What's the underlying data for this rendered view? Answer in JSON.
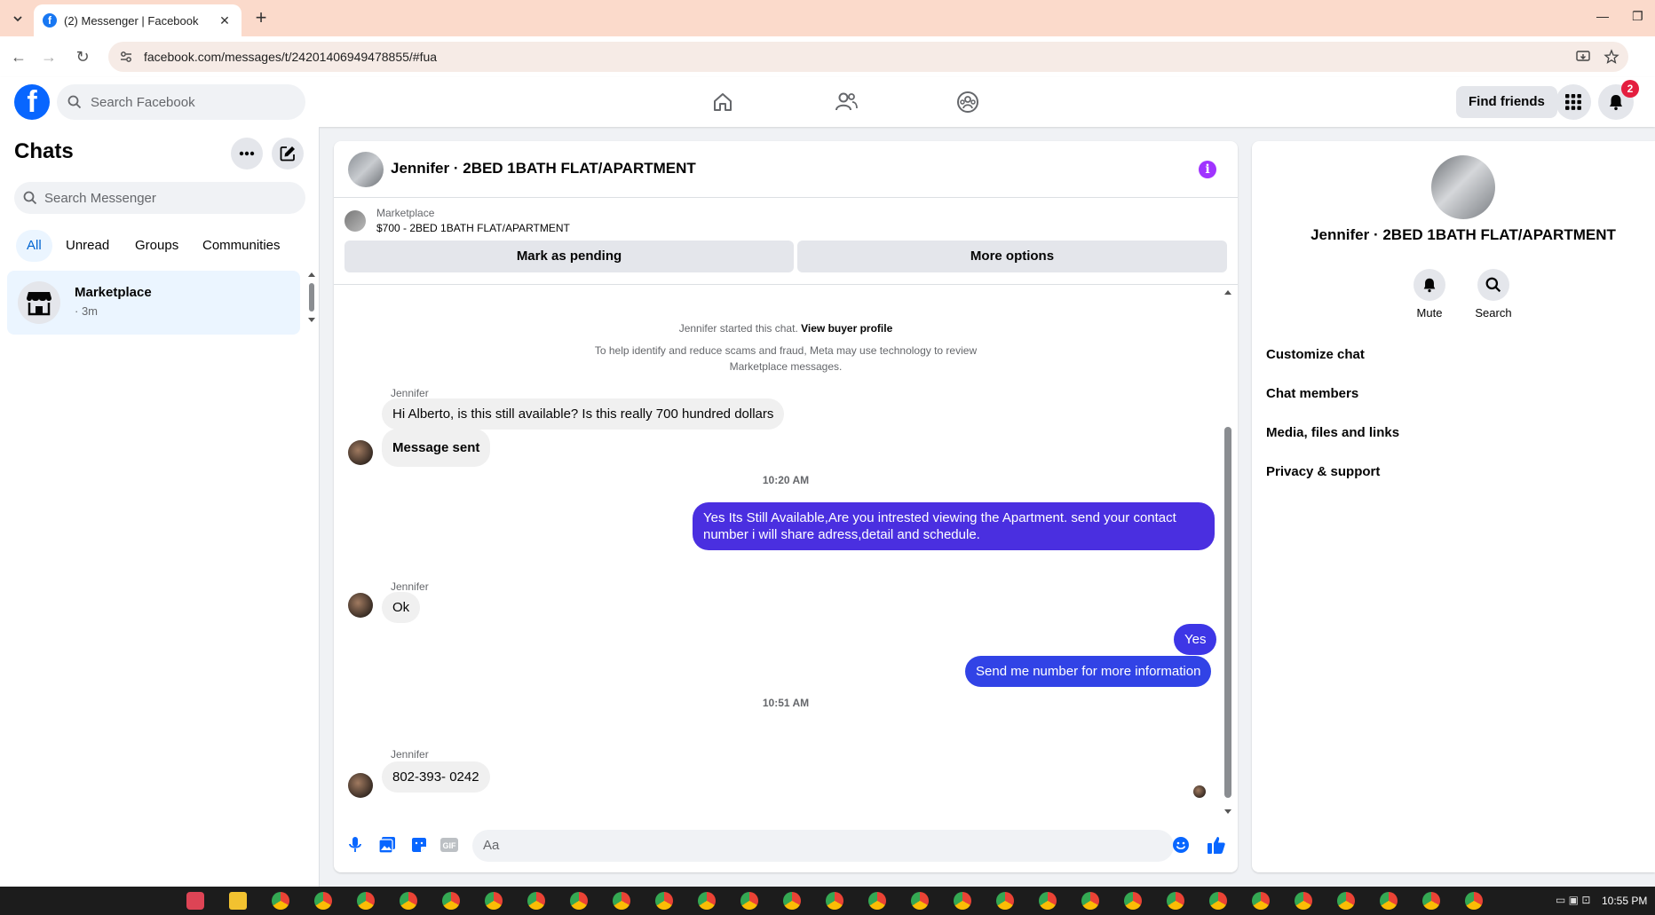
{
  "browser": {
    "tab_title": "(2) Messenger | Facebook",
    "url": "facebook.com/messages/t/24201406949478855/#fua"
  },
  "fb_nav": {
    "search_placeholder": "Search Facebook",
    "find_friends_label": "Find friends",
    "notification_count": "2"
  },
  "chats": {
    "title": "Chats",
    "search_placeholder": "Search Messenger",
    "filters": [
      "All",
      "Unread",
      "Groups",
      "Communities"
    ],
    "items": [
      {
        "name": "Marketplace",
        "time": "· 3m"
      }
    ]
  },
  "conversation": {
    "title": "Jennifer · 2BED 1BATH FLAT/APARTMENT",
    "marketplace": {
      "label": "Marketplace",
      "listing": "$700 - 2BED 1BATH FLAT/APARTMENT",
      "pending_button": "Mark as pending",
      "more_button": "More options"
    },
    "system": {
      "started": "Jennifer started this chat.",
      "profile_link": "View buyer profile",
      "notice_line1": "To help identify and reduce scams and fraud, Meta may use technology to review",
      "notice_line2": "Marketplace messages."
    },
    "messages": {
      "m1_sender": "Jennifer",
      "m1_text": "Hi Alberto, is this still available? Is this really 700 hundred dollars",
      "m2_text": "Message sent",
      "ts1": "10:20 AM",
      "m3_text": "Yes Its Still Available,Are you intrested viewing the Apartment. send your contact number i will share adress,detail and schedule.",
      "m4_sender": "Jennifer",
      "m4_text": "Ok",
      "m5_text": "Yes",
      "m6_text": "Send me number for more information",
      "ts2": "10:51 AM",
      "m7_sender": "Jennifer",
      "m7_text": "802-393- 0242"
    },
    "composer_placeholder": "Aa"
  },
  "info_panel": {
    "name": "Jennifer · 2BED 1BATH FLAT/APARTMENT",
    "mute_label": "Mute",
    "search_label": "Search",
    "sections": [
      "Customize chat",
      "Chat members",
      "Media, files and links",
      "Privacy & support"
    ]
  },
  "taskbar": {
    "time": "10:55 PM"
  },
  "colors": {
    "fb_blue": "#0866ff",
    "outgoing_bubble": "#4a2fe0",
    "incoming_bubble": "#f0f0f0",
    "tab_bar": "#fbdacb",
    "info_accent": "#a033ff"
  }
}
